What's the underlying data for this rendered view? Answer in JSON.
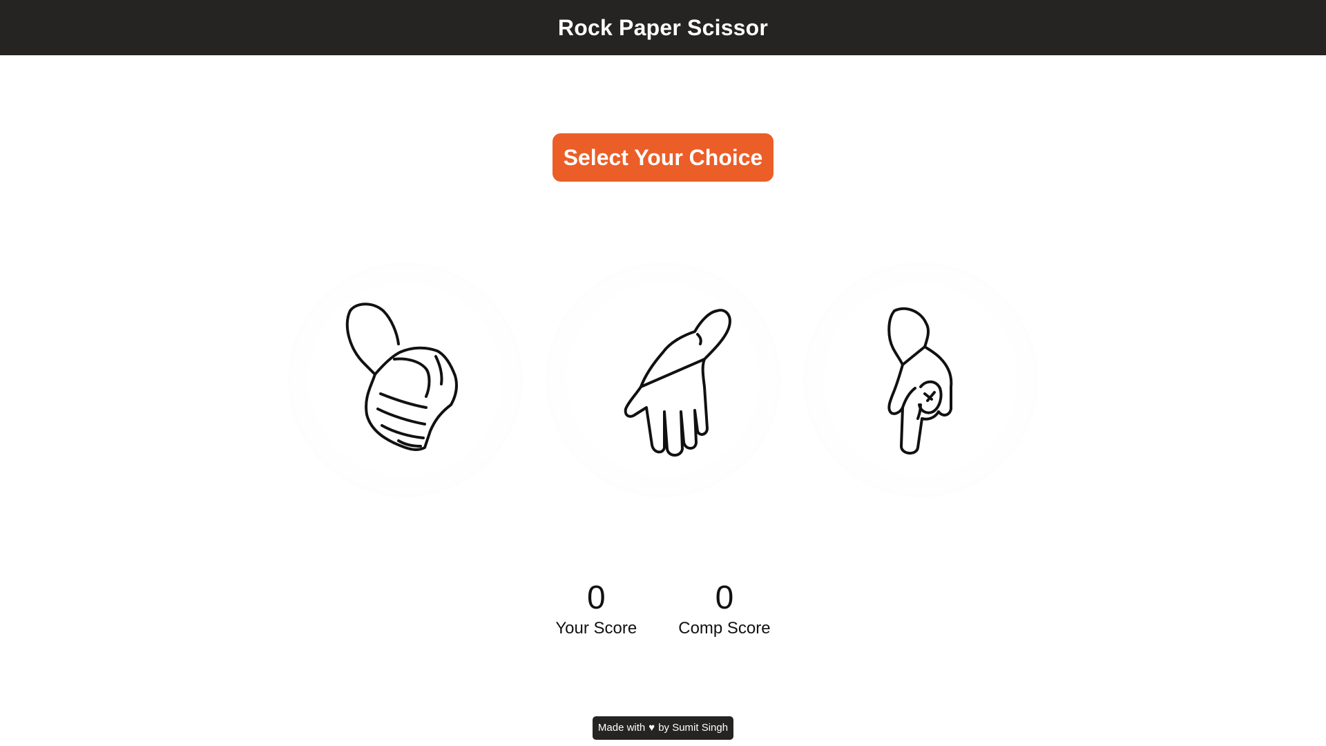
{
  "header": {
    "title": "Rock Paper Scissor"
  },
  "message": {
    "text": "Select Your Choice"
  },
  "choices": [
    {
      "id": "rock",
      "icon": "rock-hand-icon"
    },
    {
      "id": "paper",
      "icon": "paper-hand-icon"
    },
    {
      "id": "scissors",
      "icon": "scissors-hand-icon"
    }
  ],
  "scores": {
    "user": {
      "value": "0",
      "label": "Your Score"
    },
    "comp": {
      "value": "0",
      "label": "Comp Score"
    }
  },
  "footer": {
    "made_with": "Made with",
    "heart": "♥",
    "by": "by Sumit Singh"
  },
  "colors": {
    "header_bg": "#252422",
    "accent": "#eb5e28",
    "text": "#111111"
  }
}
